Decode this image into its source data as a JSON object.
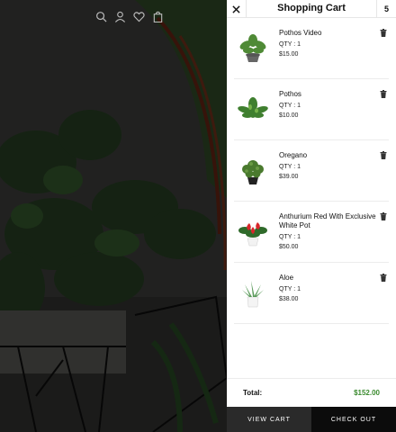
{
  "header": {
    "icons": [
      "search-icon",
      "user-icon",
      "heart-icon",
      "bag-icon"
    ]
  },
  "cart": {
    "title": "Shopping Cart",
    "count": "5",
    "items": [
      {
        "name": "Pothos Video",
        "qty": "QTY : 1",
        "price": "$15.00",
        "icon": "plant-thumb-pothos-video"
      },
      {
        "name": "Pothos",
        "qty": "QTY : 1",
        "price": "$10.00",
        "icon": "plant-thumb-pothos"
      },
      {
        "name": "Oregano",
        "qty": "QTY : 1",
        "price": "$39.00",
        "icon": "plant-thumb-oregano"
      },
      {
        "name": "Anthurium Red With Exclusive White Pot",
        "qty": "QTY : 1",
        "price": "$50.00",
        "icon": "plant-thumb-anthurium"
      },
      {
        "name": "Aloe",
        "qty": "QTY : 1",
        "price": "$38.00",
        "icon": "plant-thumb-aloe"
      }
    ],
    "total_label": "Total:",
    "total_value": "$152.00",
    "view_cart": "VIEW CART",
    "check_out": "CHECK OUT"
  },
  "colors": {
    "total": "#3a8a2e",
    "view_cart_bg": "#2a2a2a",
    "check_out_bg": "#0c0c0c"
  }
}
